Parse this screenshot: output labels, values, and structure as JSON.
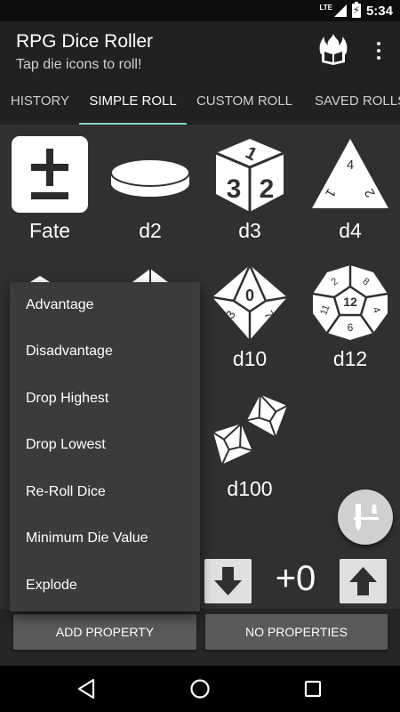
{
  "status_bar": {
    "network": "LTE",
    "time": "5:34"
  },
  "app": {
    "title": "RPG Dice Roller",
    "subtitle": "Tap die icons to roll!"
  },
  "tabs": [
    {
      "label": "HISTORY",
      "active": false
    },
    {
      "label": "SIMPLE ROLL",
      "active": true
    },
    {
      "label": "CUSTOM ROLL",
      "active": false
    },
    {
      "label": "SAVED ROLLS",
      "active": false
    }
  ],
  "dice": [
    {
      "label": "Fate",
      "icon": "fate-die-icon"
    },
    {
      "label": "d2",
      "icon": "coin-icon"
    },
    {
      "label": "d3",
      "icon": "d3-cube-icon",
      "faces": [
        "1",
        "3",
        "2"
      ]
    },
    {
      "label": "d4",
      "icon": "d4-tetrahedron-icon",
      "faces": [
        "4",
        "2",
        "1"
      ]
    },
    {
      "label": "d10",
      "icon": "d10-icon",
      "faces": [
        "0",
        "3",
        "7"
      ]
    },
    {
      "label": "d12",
      "icon": "d12-icon",
      "faces": [
        "12",
        "2",
        "8",
        "11",
        "4",
        "6"
      ]
    },
    {
      "label": "d100",
      "icon": "d100-icon"
    }
  ],
  "menu": {
    "items": [
      "Advantage",
      "Disadvantage",
      "Drop Highest",
      "Drop Lowest",
      "Re-Roll Dice",
      "Minimum Die Value",
      "Explode"
    ]
  },
  "modifier": {
    "value": "+0"
  },
  "buttons": {
    "add_property": "ADD PROPERTY",
    "no_properties": "NO PROPERTIES"
  },
  "colors": {
    "accent": "#7fd6c7",
    "background": "#303030",
    "app_bar": "#212121"
  }
}
